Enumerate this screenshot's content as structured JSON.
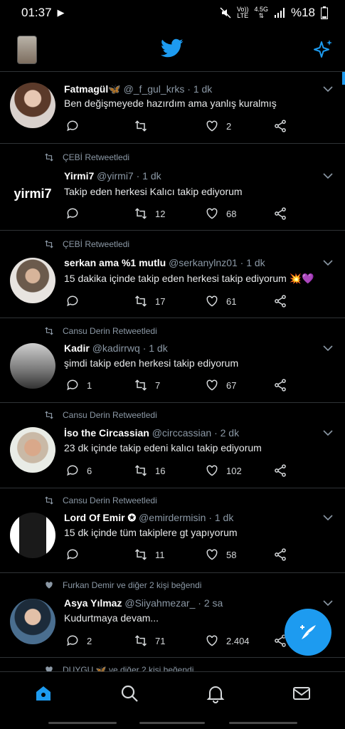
{
  "status": {
    "time": "01:37",
    "volte_top": "Vo))",
    "volte_bottom": "LTE",
    "net_top": "4.5G",
    "net_bottom": "⇅",
    "battery": "%18"
  },
  "tweets": [
    {
      "context": "",
      "name": "Fatmagül🦋",
      "handle": "@_f_gul_krks",
      "time": "· 1 dk",
      "text": "Ben değişmeyede hazırdım ama yanlış kuralmış",
      "replies": "",
      "retweets": "",
      "likes": "2"
    },
    {
      "context": "ÇEBİ Retweetledi",
      "name": "Yirmi7",
      "handle": "@yirmi7",
      "time": "· 1 dk",
      "text": "Takip eden herkesi Kalıcı takip ediyorum",
      "replies": "",
      "retweets": "12",
      "likes": "68",
      "avatar_text": "yirmi7"
    },
    {
      "context": "ÇEBİ Retweetledi",
      "name": "serkan ama %1 mutlu",
      "handle": "@serkanylnz01",
      "time": "· 1 dk",
      "text": "15 dakika içinde takip eden herkesi takip ediyorum 💥💜",
      "replies": "",
      "retweets": "17",
      "likes": "61"
    },
    {
      "context": "Cansu Derin Retweetledi",
      "name": "Kadir",
      "handle": "@kadirrwq",
      "time": "· 1 dk",
      "text": "şimdi takip eden herkesi takip ediyorum",
      "replies": "1",
      "retweets": "7",
      "likes": "67"
    },
    {
      "context": "Cansu Derin Retweetledi",
      "name": "İso the Circassian",
      "handle": "@circcassian",
      "time": "· 2 dk",
      "text": "23 dk içinde takip edeni kalıcı takip ediyorum",
      "replies": "6",
      "retweets": "16",
      "likes": "102"
    },
    {
      "context": "Cansu Derin Retweetledi",
      "name": "Lord Of Emir ✪",
      "handle": "@emirdermisin",
      "time": "· 1 dk",
      "text": "15 dk içinde tüm takiplere gt yapıyorum",
      "replies": "",
      "retweets": "11",
      "likes": "58"
    },
    {
      "context": "Furkan Demir ve diğer 2 kişi beğendi",
      "name": "Asya Yılmaz",
      "handle": "@Siiyahmezar_",
      "time": "· 2 sa",
      "text": "Kudurtmaya devam...",
      "replies": "2",
      "retweets": "71",
      "likes": "2.404"
    }
  ],
  "partial_context": "DUYGU 🦋 ve diğer 2 kişi beğendi",
  "colors": {
    "accent": "#1d9bf0",
    "bg": "#000000",
    "muted": "#8b98a5",
    "border": "#2f3336"
  },
  "icons": {
    "logo": "twitter-bird-icon",
    "sparkle": "sparkle-icon",
    "compose": "compose-icon",
    "nav": [
      "home-icon",
      "search-icon",
      "bell-icon",
      "mail-icon"
    ]
  }
}
